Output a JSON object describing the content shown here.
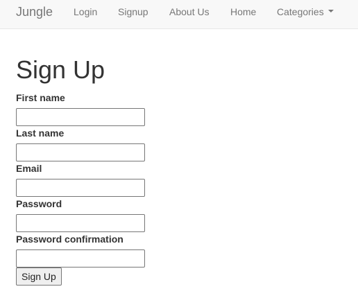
{
  "navbar": {
    "brand": "Jungle",
    "items": [
      {
        "label": "Login"
      },
      {
        "label": "Signup"
      },
      {
        "label": "About Us"
      },
      {
        "label": "Home"
      },
      {
        "label": "Categories"
      }
    ],
    "colors": {
      "background": "#f8f8f8",
      "text": "#777777",
      "border": "#e7e7e7"
    }
  },
  "page": {
    "title": "Sign Up"
  },
  "form": {
    "fields": [
      {
        "label": "First name",
        "value": "",
        "placeholder": ""
      },
      {
        "label": "Last name",
        "value": "",
        "placeholder": ""
      },
      {
        "label": "Email",
        "value": "",
        "placeholder": ""
      },
      {
        "label": "Password",
        "value": "",
        "placeholder": ""
      },
      {
        "label": "Password confirmation",
        "value": "",
        "placeholder": ""
      }
    ],
    "submit_label": "Sign Up"
  },
  "icons": {
    "categories_dropdown": "caret-down-icon"
  }
}
